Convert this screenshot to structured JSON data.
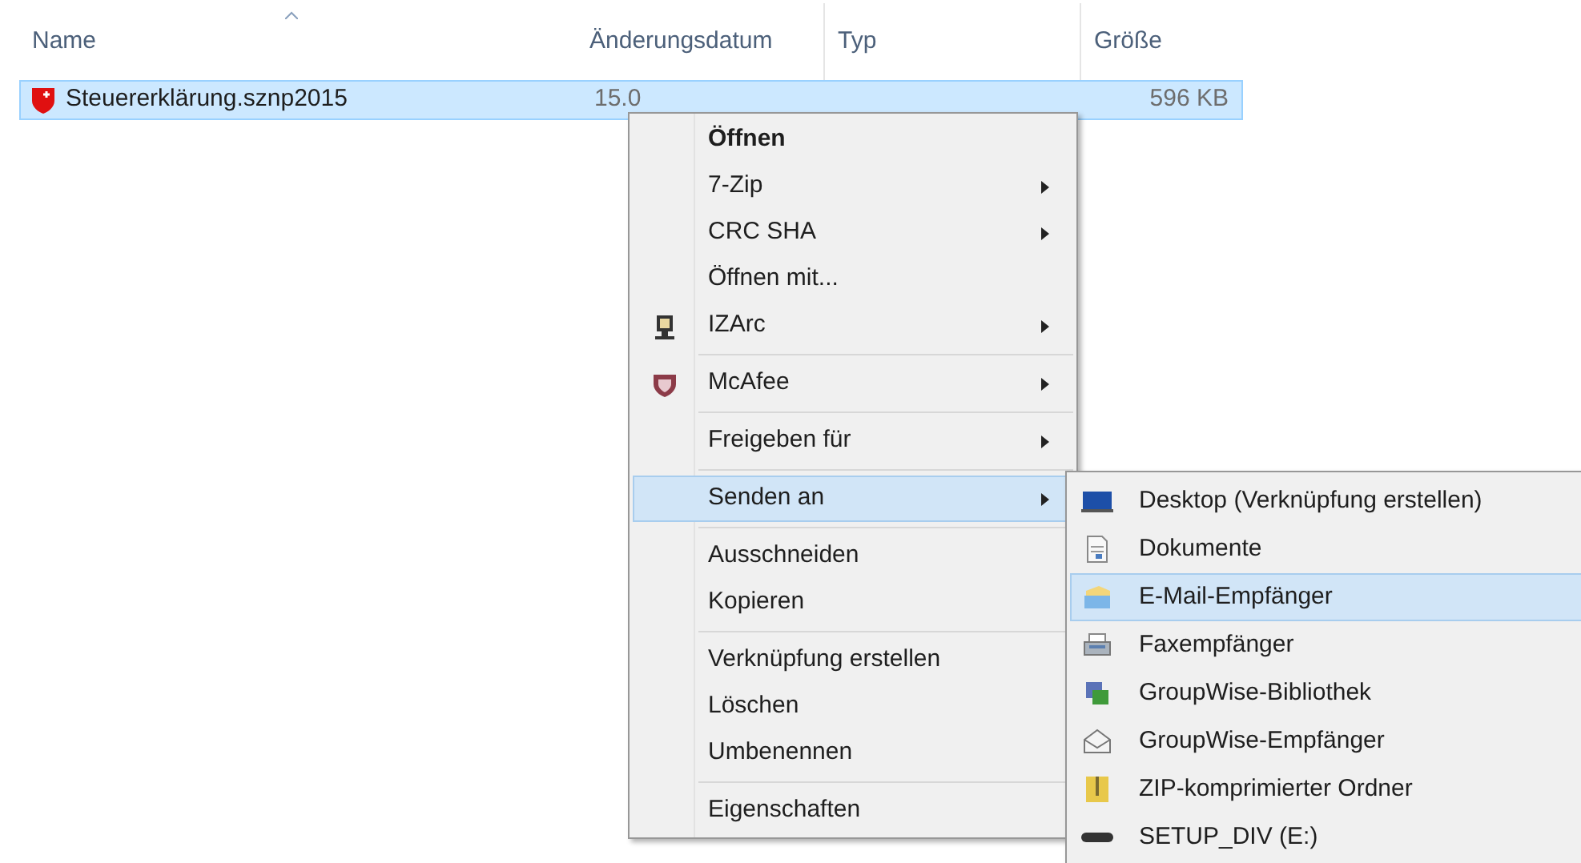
{
  "columns": [
    {
      "label": "Name",
      "sorted": true
    },
    {
      "label": "Änderungsdatum",
      "sorted": false
    },
    {
      "label": "Typ",
      "sorted": false
    },
    {
      "label": "Größe",
      "sorted": false
    }
  ],
  "files": [
    {
      "name": "Steuererklärung.sznp2015",
      "date": "15.0",
      "size": "596 KB",
      "selected": true
    }
  ],
  "context_menu": [
    {
      "kind": "plain",
      "label": "Öffnen",
      "bold": true,
      "submenu": false,
      "selected": false
    },
    {
      "kind": "plain",
      "label": "7-Zip",
      "bold": false,
      "submenu": true,
      "selected": false
    },
    {
      "kind": "plain",
      "label": "CRC SHA",
      "bold": false,
      "submenu": true,
      "selected": false
    },
    {
      "kind": "plain",
      "label": "Öffnen mit...",
      "bold": false,
      "submenu": false,
      "selected": false
    },
    {
      "kind": "izarc",
      "label": "IZArc",
      "bold": false,
      "submenu": true,
      "selected": false
    },
    {
      "kind": "separator"
    },
    {
      "kind": "shield",
      "label": "McAfee",
      "bold": false,
      "submenu": true,
      "selected": false
    },
    {
      "kind": "separator"
    },
    {
      "kind": "plain",
      "label": "Freigeben für",
      "bold": false,
      "submenu": true,
      "selected": false
    },
    {
      "kind": "separator"
    },
    {
      "kind": "plain",
      "label": "Senden an",
      "bold": false,
      "submenu": true,
      "selected": true
    },
    {
      "kind": "separator"
    },
    {
      "kind": "plain",
      "label": "Ausschneiden",
      "bold": false,
      "submenu": false,
      "selected": false
    },
    {
      "kind": "plain",
      "label": "Kopieren",
      "bold": false,
      "submenu": false,
      "selected": false
    },
    {
      "kind": "separator"
    },
    {
      "kind": "plain",
      "label": "Verknüpfung erstellen",
      "bold": false,
      "submenu": false,
      "selected": false
    },
    {
      "kind": "plain",
      "label": "Löschen",
      "bold": false,
      "submenu": false,
      "selected": false
    },
    {
      "kind": "plain",
      "label": "Umbenennen",
      "bold": false,
      "submenu": false,
      "selected": false
    },
    {
      "kind": "separator"
    },
    {
      "kind": "plain",
      "label": "Eigenschaften",
      "bold": false,
      "submenu": false,
      "selected": false
    }
  ],
  "send_to_menu": [
    {
      "label": "Desktop (Verknüpfung erstellen)",
      "kind": "monitor",
      "selected": false
    },
    {
      "label": "Dokumente",
      "kind": "document",
      "selected": false
    },
    {
      "label": "E-Mail-Empfänger",
      "kind": "mail",
      "selected": true
    },
    {
      "label": "Faxempfänger",
      "kind": "fax",
      "selected": false
    },
    {
      "label": "GroupWise-Bibliothek",
      "kind": "library",
      "selected": false
    },
    {
      "label": "GroupWise-Empfänger",
      "kind": "envelope",
      "selected": false
    },
    {
      "label": "ZIP-komprimierter Ordner",
      "kind": "zip",
      "selected": false
    },
    {
      "label": "SETUP_DIV (E:)",
      "kind": "drive",
      "selected": false
    }
  ]
}
